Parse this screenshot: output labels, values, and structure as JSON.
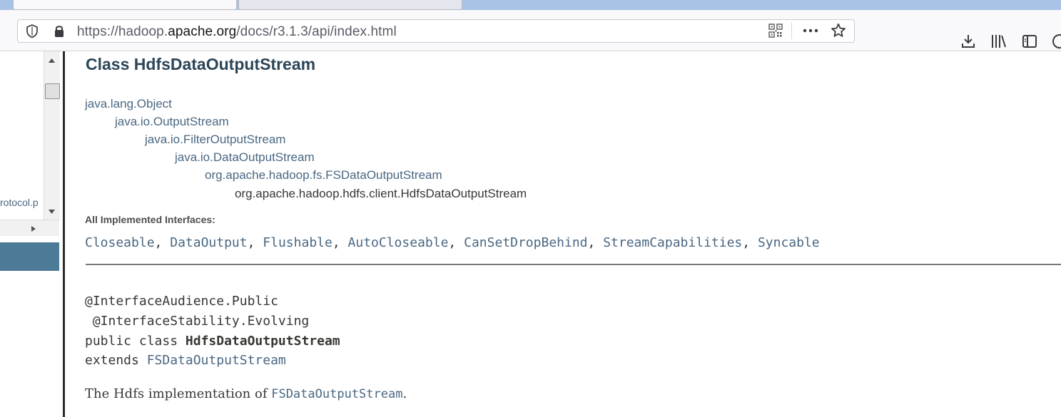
{
  "browser": {
    "tabs": [
      {
        "label": ""
      },
      {
        "label": ""
      }
    ],
    "url": {
      "prefix": "https://hadoop.",
      "domain": "apache.org",
      "path": "/docs/r3.1.3/api/index.html"
    },
    "icons": [
      "shield-icon",
      "lock-icon",
      "qr-code-icon",
      "more-icon",
      "bookmark-star-icon",
      "download-icon",
      "library-icon",
      "sidebar-icon"
    ]
  },
  "left_frame": {
    "partial_link": "rotocol.p"
  },
  "page": {
    "title": "Class HdfsDataOutputStream",
    "inheritance": [
      "java.lang.Object",
      "java.io.OutputStream",
      "java.io.FilterOutputStream",
      "java.io.DataOutputStream",
      "org.apache.hadoop.fs.FSDataOutputStream",
      "org.apache.hadoop.hdfs.client.HdfsDataOutputStream"
    ],
    "implemented_label": "All Implemented Interfaces:",
    "interfaces": [
      "Closeable",
      "DataOutput",
      "Flushable",
      "AutoCloseable",
      "CanSetDropBehind",
      "StreamCapabilities",
      "Syncable"
    ],
    "annotation1": "@InterfaceAudience.Public",
    "annotation2": " @InterfaceStability.Evolving",
    "decl_prefix": "public class ",
    "decl_class": "HdfsDataOutputStream",
    "extends_prefix": "extends ",
    "extends_class": "FSDataOutputStream",
    "desc_prefix": "The Hdfs implementation of ",
    "desc_link": "FSDataOutputStream",
    "desc_suffix": "."
  },
  "colors": {
    "link": "#4a6782",
    "title": "#2c4557",
    "tabstrip": "#a9c3e6",
    "left_blue": "#4d7a97"
  }
}
